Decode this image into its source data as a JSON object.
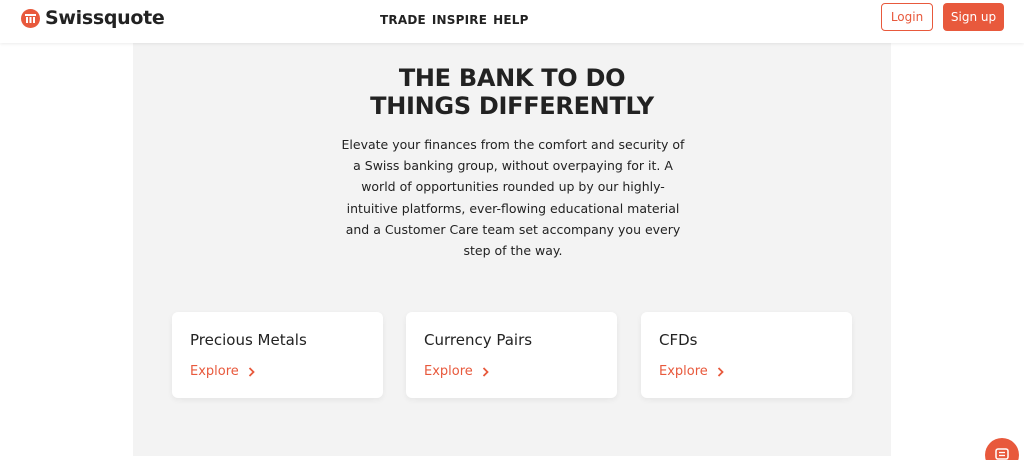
{
  "header": {
    "brand": "Swissquote",
    "nav": [
      "TRADE",
      "INSPIRE",
      "HELP"
    ],
    "login_label": "Login",
    "signup_label": "Sign up"
  },
  "hero": {
    "title_line1": "THE BANK TO DO",
    "title_line2": "THINGS DIFFERENTLY",
    "body": "Elevate your finances from the comfort and security of a Swiss banking group, without overpaying for it. A world of opportunities rounded up by our highly-intuitive platforms, ever-flowing educational material and a Customer Care team set accompany you every step of the way."
  },
  "cards": [
    {
      "title": "Precious Metals",
      "link": "Explore"
    },
    {
      "title": "Currency Pairs",
      "link": "Explore"
    },
    {
      "title": "CFDs",
      "link": "Explore"
    }
  ],
  "icons": {
    "brand_mark": "swissquote-logo-icon",
    "card_arrow": "chevron-right-icon",
    "chat": "chat-icon"
  },
  "colors": {
    "accent": "#e8593c",
    "panel_bg": "#f3f3f3",
    "text": "#222222"
  }
}
